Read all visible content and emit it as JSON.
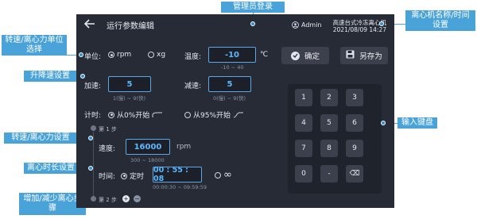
{
  "header": {
    "back_icon": "arrow-left-icon",
    "title": "运行参数编辑",
    "user_icon": "user-circle-icon",
    "user": "Admin",
    "device_name": "高速台式冷冻离心机",
    "datetime": "2021/08/09 14:27"
  },
  "unit": {
    "label": "单位:",
    "option_rpm": "rpm",
    "option_xg": "xg",
    "selected": "rpm"
  },
  "temperature": {
    "label": "温度:",
    "value": "-10",
    "unit": "℃",
    "range": "-10 ~ 40"
  },
  "buttons": {
    "confirm": "确定",
    "save_as": "另存为"
  },
  "accel": {
    "label": "加速:",
    "value": "5",
    "range": "1(慢) ~ 9(快)"
  },
  "decel": {
    "label": "减速:",
    "value": "5",
    "range": "0(慢) ~ 9(快)"
  },
  "timing": {
    "label": "计时:",
    "option_0": "从0%开始",
    "option_95": "从95%开始",
    "selected": "从0%开始"
  },
  "step1": {
    "label": "第 1 步",
    "speed_label": "速度:",
    "speed_value": "16000",
    "speed_unit": "rpm",
    "speed_range": "300 ~ 18000",
    "time_label": "时间:",
    "timed_option": "定时",
    "time_value": "00 : 55 : 08",
    "time_range": "00:00:30 ~ 09:59:59",
    "infinite_symbol": "∞"
  },
  "step2": {
    "label": "第 2 步"
  },
  "keypad": [
    "1",
    "2",
    "3",
    "4",
    "5",
    "6",
    "7",
    "8",
    "9",
    "0",
    "-",
    "⌫"
  ],
  "callouts": {
    "admin_login": "管理员登录",
    "device_name_time": "离心机名称/时间设置",
    "unit_select": "转速/离心力单位选择",
    "accel_decel": "升降速设置",
    "speed_force": "转速/离心力设置",
    "duration": "离心时长设置",
    "add_remove_step": "增加/减少离心步骤",
    "keypad": "输入键盘"
  },
  "colors": {
    "screen_bg": "#262b36",
    "accent": "#5cb8ff",
    "callout": "#4aa3d8"
  }
}
